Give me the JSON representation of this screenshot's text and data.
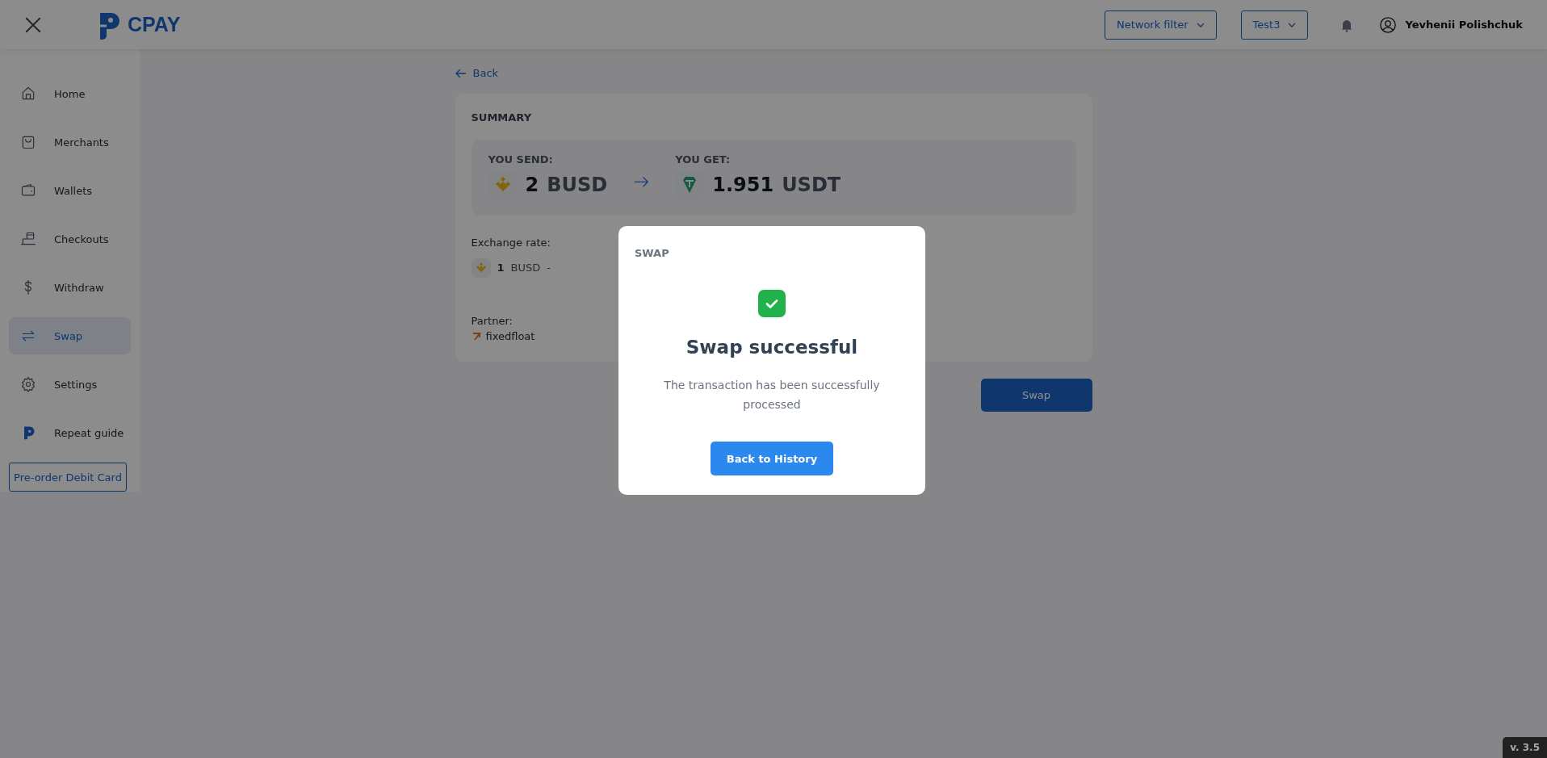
{
  "header": {
    "brand": "CPAY",
    "network_filter": "Network filter",
    "project": "Test3",
    "user": "Yevhenii Polishchuk"
  },
  "sidebar": {
    "items": [
      {
        "label": "Home",
        "selected": false
      },
      {
        "label": "Merchants",
        "selected": false
      },
      {
        "label": "Wallets",
        "selected": false
      },
      {
        "label": "Checkouts",
        "selected": false
      },
      {
        "label": "Withdraw",
        "selected": false
      },
      {
        "label": "Swap",
        "selected": true
      },
      {
        "label": "Settings",
        "selected": false
      },
      {
        "label": "Repeat guide",
        "selected": false
      }
    ],
    "promo_button": "Pre-order Debit Card"
  },
  "back_link": "Back",
  "summary": {
    "title": "SUMMARY",
    "send": {
      "label": "YOU SEND:",
      "amount": "2",
      "currency": "BUSD"
    },
    "get": {
      "label": "YOU GET:",
      "amount": "1.951",
      "currency": "USDT"
    },
    "exchange_rate": {
      "label": "Exchange rate:",
      "amount": "1",
      "currency": "BUSD",
      "separator": "-"
    },
    "partner": {
      "label": "Partner:",
      "name": "fixedfloat"
    }
  },
  "swap_button": "Swap",
  "modal": {
    "title": "SWAP",
    "heading": "Swap successful",
    "message": "The transaction has been successfully processed",
    "button": "Back to History"
  },
  "version": "v. 3.5"
}
